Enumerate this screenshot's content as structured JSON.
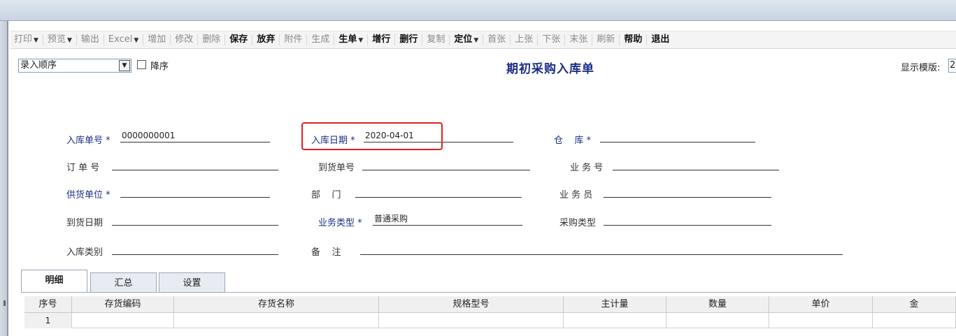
{
  "toolbar": {
    "items": [
      {
        "label": "打印",
        "dropdown": true,
        "state": "disabled"
      },
      {
        "label": "预览",
        "dropdown": true,
        "state": "disabled"
      },
      {
        "label": "输出",
        "dropdown": false,
        "state": "disabled"
      },
      {
        "label": "Excel",
        "dropdown": true,
        "state": "disabled"
      },
      {
        "label": "增加",
        "dropdown": false,
        "state": "disabled"
      },
      {
        "label": "修改",
        "dropdown": false,
        "state": "disabled"
      },
      {
        "label": "删除",
        "dropdown": false,
        "state": "disabled"
      },
      {
        "label": "保存",
        "dropdown": false,
        "state": "active"
      },
      {
        "label": "放弃",
        "dropdown": false,
        "state": "active"
      },
      {
        "label": "附件",
        "dropdown": false,
        "state": "disabled"
      },
      {
        "label": "生成",
        "dropdown": false,
        "state": "disabled"
      },
      {
        "label": "生单",
        "dropdown": true,
        "state": "active"
      },
      {
        "label": "增行",
        "dropdown": false,
        "state": "active"
      },
      {
        "label": "删行",
        "dropdown": false,
        "state": "active"
      },
      {
        "label": "复制",
        "dropdown": false,
        "state": "disabled"
      },
      {
        "label": "定位",
        "dropdown": true,
        "state": "active"
      },
      {
        "label": "首张",
        "dropdown": false,
        "state": "disabled"
      },
      {
        "label": "上张",
        "dropdown": false,
        "state": "disabled"
      },
      {
        "label": "下张",
        "dropdown": false,
        "state": "disabled"
      },
      {
        "label": "末张",
        "dropdown": false,
        "state": "disabled"
      },
      {
        "label": "刷新",
        "dropdown": false,
        "state": "disabled"
      },
      {
        "label": "帮助",
        "dropdown": false,
        "state": "active"
      },
      {
        "label": "退出",
        "dropdown": false,
        "state": "active"
      }
    ]
  },
  "sort": {
    "selected": "录入顺序",
    "desc_label": "降序"
  },
  "document": {
    "title": "期初采购入库单",
    "template_label": "显示模版:",
    "template_value": "2"
  },
  "fields": {
    "receipt_no": {
      "label": "入库单号",
      "value": "0000000001"
    },
    "receipt_date": {
      "label": "入库日期",
      "value": "2020-04-01"
    },
    "warehouse": {
      "label": "仓    库",
      "value": ""
    },
    "order_no": {
      "label": "订 单 号",
      "value": ""
    },
    "arrival_no": {
      "label": "到货单号",
      "value": ""
    },
    "business_no": {
      "label": "业 务 号",
      "value": ""
    },
    "supplier": {
      "label": "供货单位",
      "value": ""
    },
    "department": {
      "label": "部    门",
      "value": ""
    },
    "clerk": {
      "label": "业 务 员",
      "value": ""
    },
    "arrival_date": {
      "label": "到货日期",
      "value": ""
    },
    "business_type": {
      "label": "业务类型",
      "value": "普通采购"
    },
    "purchase_type": {
      "label": "采购类型",
      "value": ""
    },
    "receipt_category": {
      "label": "入库类别",
      "value": ""
    },
    "remark": {
      "label": "备    注",
      "value": ""
    }
  },
  "required_mark": "*",
  "tabs": [
    "明细",
    "汇总",
    "设置"
  ],
  "grid": {
    "columns": [
      "序号",
      "存货编码",
      "存货名称",
      "规格型号",
      "主计量",
      "数量",
      "单价",
      "金"
    ],
    "rows": [
      [
        "1",
        "",
        "",
        "",
        "",
        "",
        "",
        ""
      ]
    ]
  }
}
